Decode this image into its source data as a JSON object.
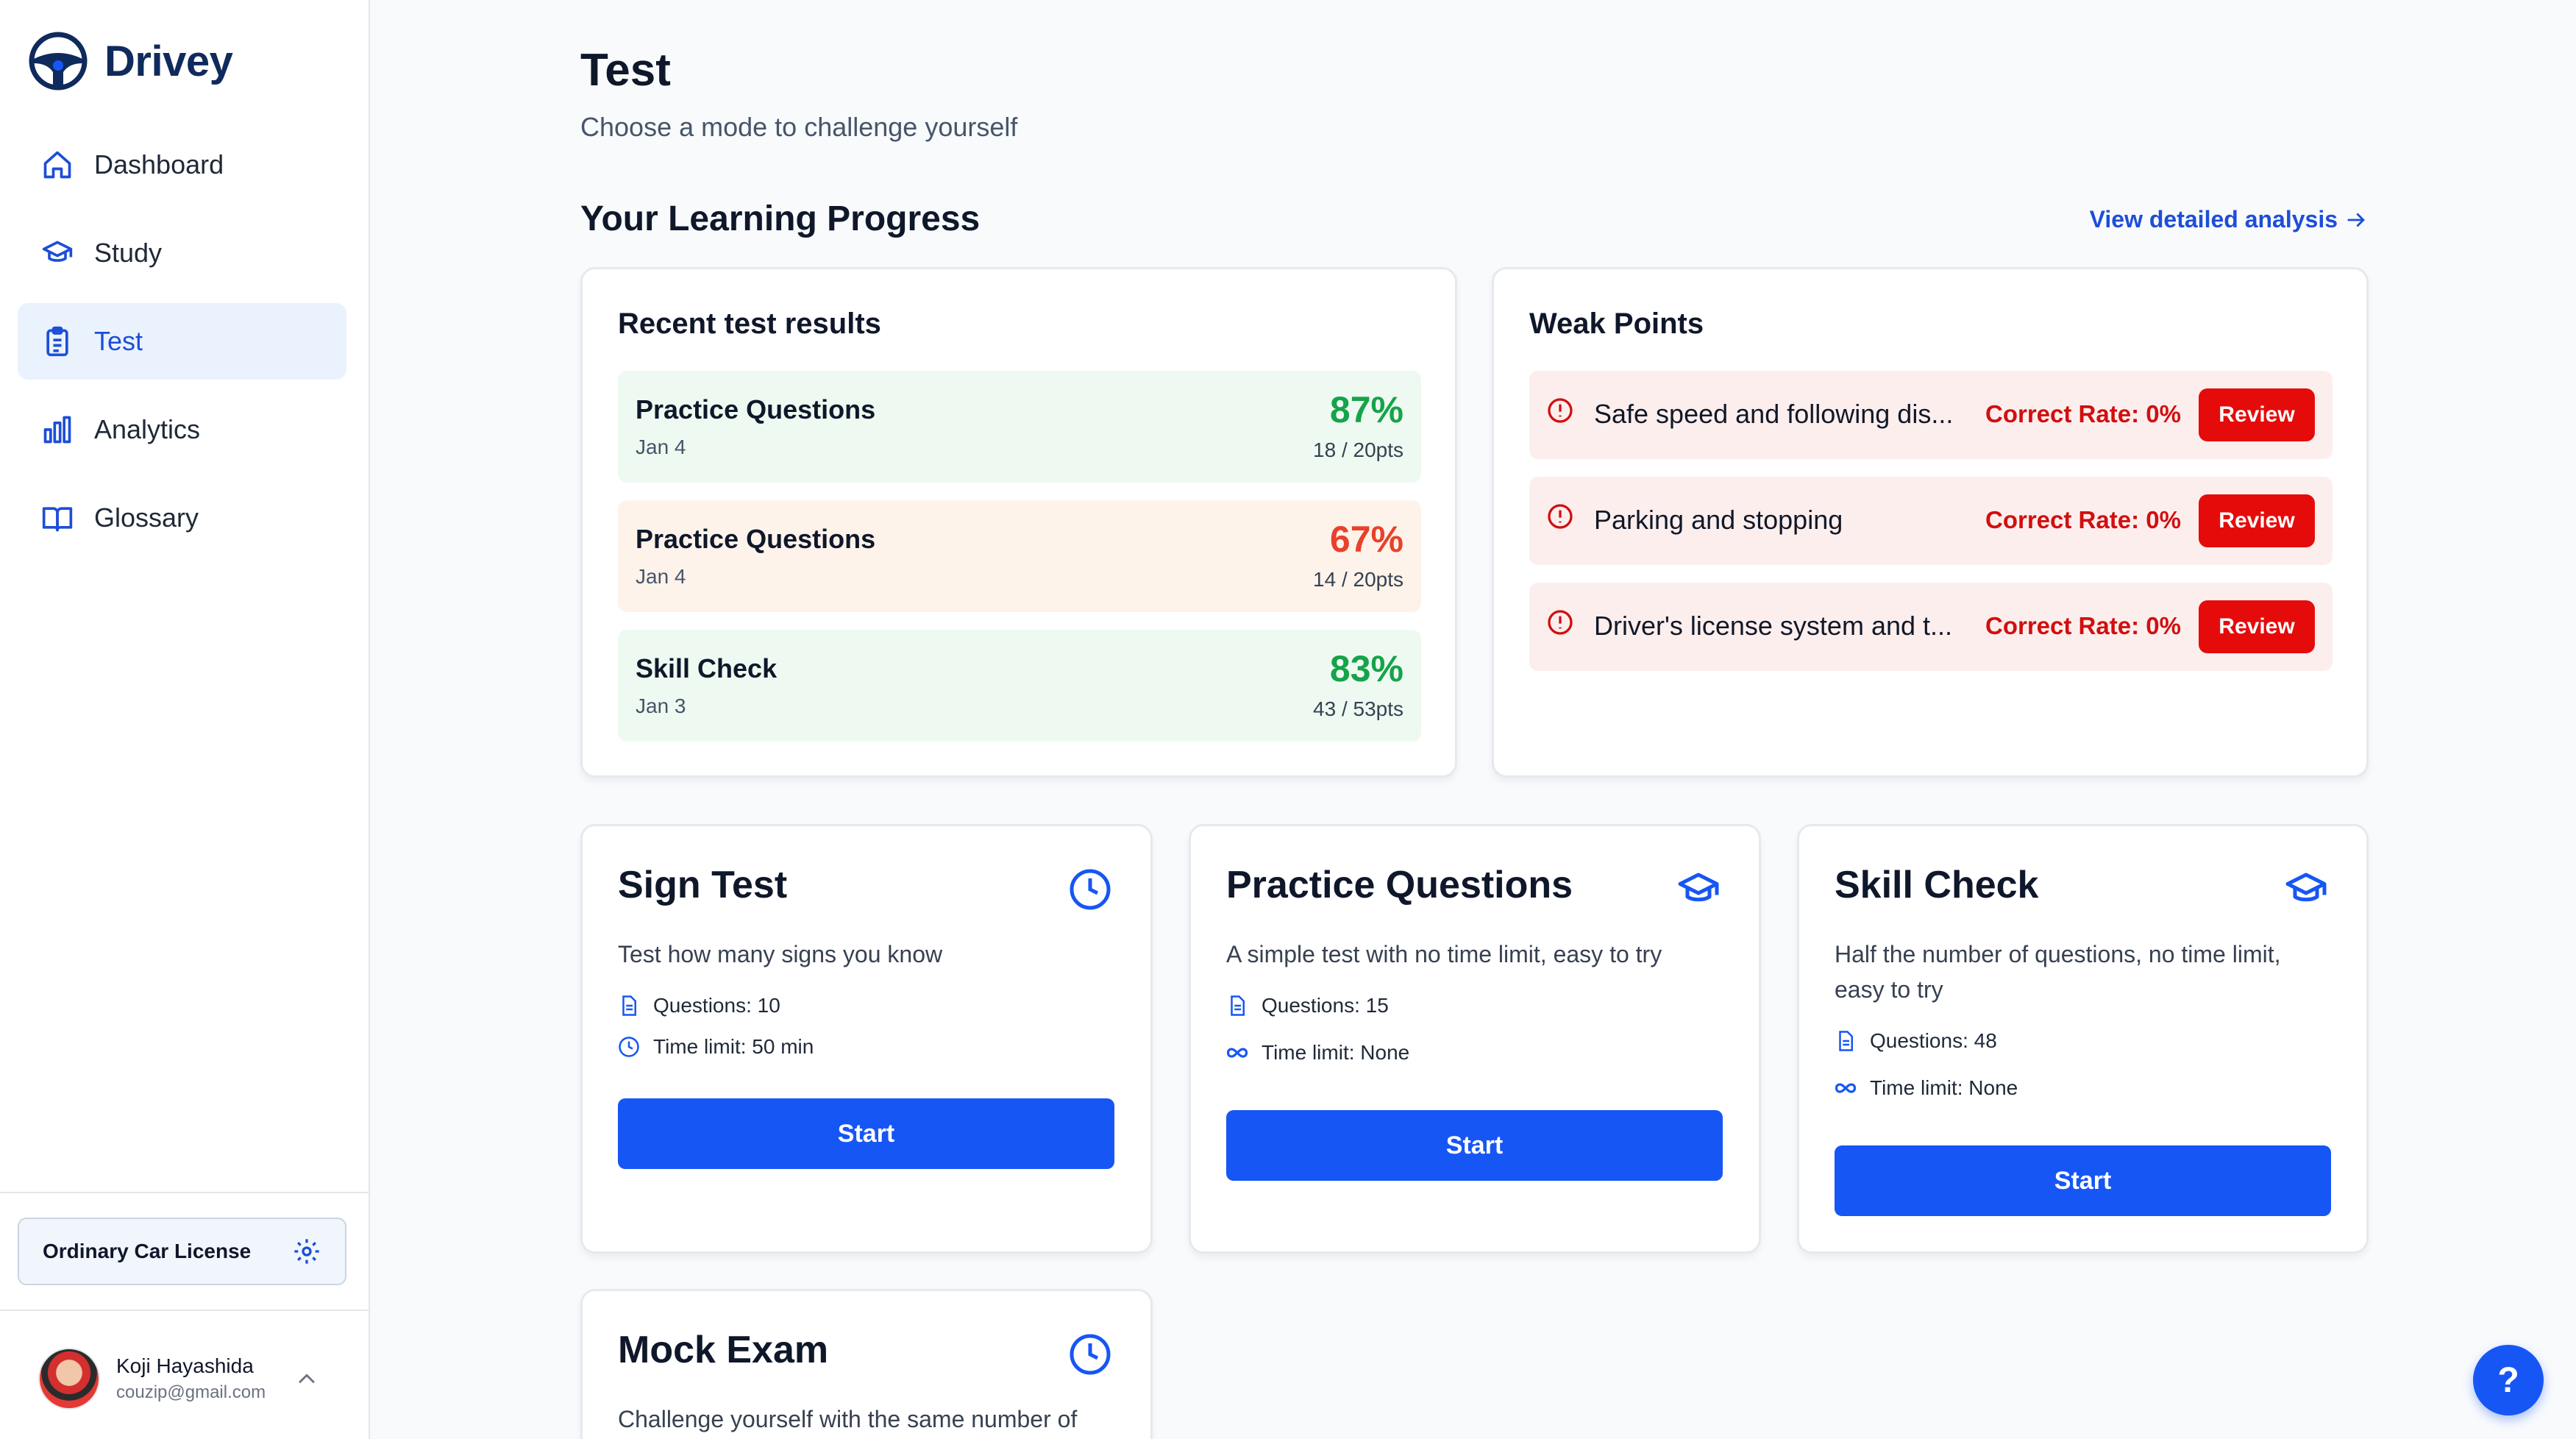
{
  "brand": {
    "name": "Drivey",
    "accent": "#1656f5"
  },
  "sidebar": {
    "items": [
      {
        "label": "Dashboard",
        "icon": "home-icon"
      },
      {
        "label": "Study",
        "icon": "graduation-cap-icon"
      },
      {
        "label": "Test",
        "icon": "clipboard-icon",
        "active": true
      },
      {
        "label": "Analytics",
        "icon": "bar-chart-icon"
      },
      {
        "label": "Glossary",
        "icon": "book-icon"
      }
    ],
    "license": "Ordinary Car License",
    "user": {
      "name": "Koji Hayashida",
      "email": "couzip@gmail.com"
    }
  },
  "header": {
    "title": "Test",
    "subtitle": "Choose a mode to challenge yourself"
  },
  "progress": {
    "title": "Your Learning Progress",
    "detail_link": "View detailed analysis"
  },
  "recent": {
    "title": "Recent test results",
    "rows": [
      {
        "name": "Practice Questions",
        "date": "Jan 4",
        "pct": "87%",
        "pts": "18 / 20pts",
        "status": "good"
      },
      {
        "name": "Practice Questions",
        "date": "Jan 4",
        "pct": "67%",
        "pts": "14 / 20pts",
        "status": "warn"
      },
      {
        "name": "Skill Check",
        "date": "Jan 3",
        "pct": "83%",
        "pts": "43 / 53pts",
        "status": "good"
      }
    ]
  },
  "weak": {
    "title": "Weak Points",
    "review_label": "Review",
    "rows": [
      {
        "topic": "Safe speed and following dis...",
        "rate": "Correct Rate: 0%"
      },
      {
        "topic": "Parking and stopping",
        "rate": "Correct Rate: 0%"
      },
      {
        "topic": "Driver's license system and t...",
        "rate": "Correct Rate: 0%"
      }
    ]
  },
  "modes": {
    "start_label": "Start",
    "sign": {
      "title": "Sign Test",
      "desc": "Test how many signs you know",
      "questions": "Questions: 10",
      "time": "Time limit: 50 min"
    },
    "practice": {
      "title": "Practice Questions",
      "desc": "A simple test with no time limit, easy to try",
      "questions": "Questions: 15",
      "time": "Time limit: None"
    },
    "skill": {
      "title": "Skill Check",
      "desc": "Half the number of questions, no time limit, easy to try",
      "questions": "Questions: 48",
      "time": "Time limit: None"
    },
    "mock": {
      "title": "Mock Exam",
      "desc": "Challenge yourself with the same number of"
    }
  },
  "help_label": "?"
}
